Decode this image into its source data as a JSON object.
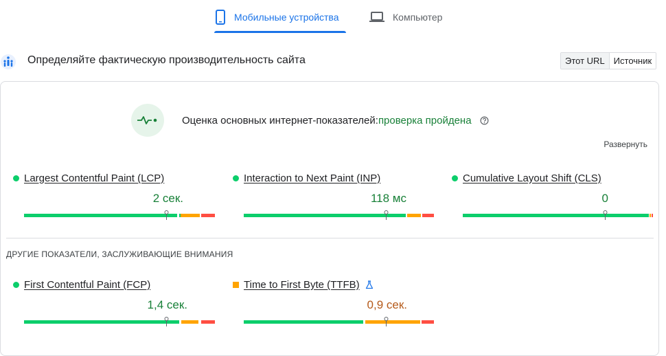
{
  "tabs": [
    {
      "label": "Мобильные устройства",
      "active": true,
      "icon": "smartphone-icon"
    },
    {
      "label": "Компьютер",
      "active": false,
      "icon": "laptop-icon"
    }
  ],
  "section": {
    "title": "Определяйте фактическую производительность сайта",
    "toggle": {
      "this_url": "Этот URL",
      "origin": "Источник"
    }
  },
  "assessment": {
    "label": "Оценка основных интернет-показателей:",
    "status": "проверка пройдена",
    "expand": "Развернуть"
  },
  "core_metrics": [
    {
      "name": "Largest Contentful Paint (LCP)",
      "value": "2 сек.",
      "rating": "good"
    },
    {
      "name": "Interaction to Next Paint (INP)",
      "value": "118 мс",
      "rating": "good"
    },
    {
      "name": "Cumulative Layout Shift (CLS)",
      "value": "0",
      "rating": "good"
    }
  ],
  "other_title": "ДРУГИЕ ПОКАЗАТЕЛИ, ЗАСЛУЖИВАЮЩИЕ ВНИМАНИЯ",
  "other_metrics": [
    {
      "name": "First Contentful Paint (FCP)",
      "value": "1,4 сек.",
      "rating": "good"
    },
    {
      "name": "Time to First Byte (TTFB)",
      "value": "0,9 сек.",
      "rating": "average",
      "experimental": true
    }
  ],
  "colors": {
    "accent": "#1a73e8",
    "good": "#0cce6b",
    "needs_improvement": "#ffa400",
    "poor": "#ff4e42",
    "pass_text": "#188038"
  }
}
